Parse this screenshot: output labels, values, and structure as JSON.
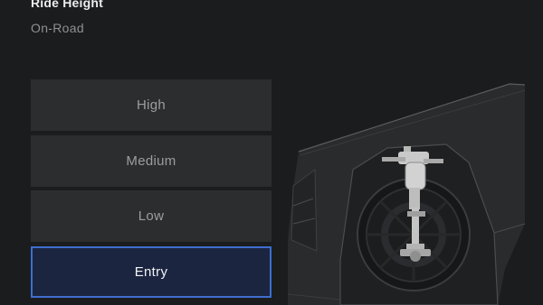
{
  "header": {
    "title": "Ride Height",
    "subtitle": "On-Road"
  },
  "options": [
    {
      "label": "High",
      "selected": false
    },
    {
      "label": "Medium",
      "selected": false
    },
    {
      "label": "Low",
      "selected": false
    },
    {
      "label": "Entry",
      "selected": true
    }
  ],
  "colors": {
    "background": "#1b1c1e",
    "option_bg": "#2c2d2f",
    "selected_bg": "#1c2540",
    "selected_border": "#3e6ed0"
  },
  "illustration": {
    "icon": "vehicle-suspension-illustration"
  }
}
